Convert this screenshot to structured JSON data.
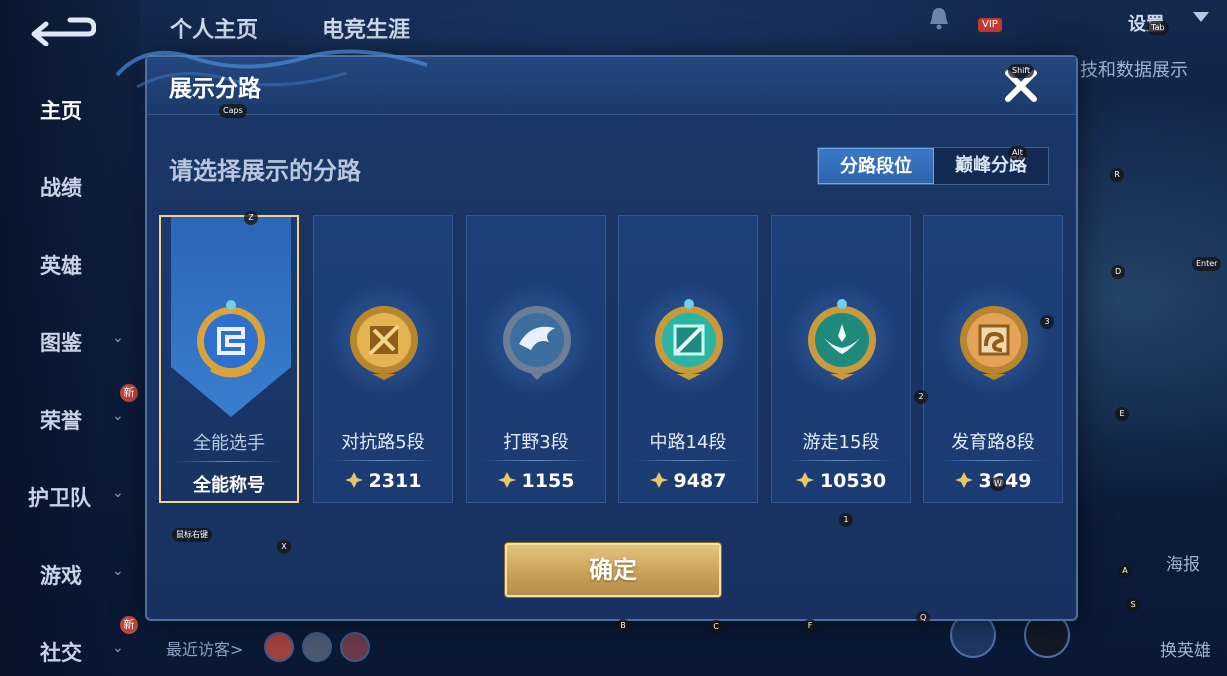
{
  "background": {
    "nav": [
      {
        "label": "主页",
        "active": true
      },
      {
        "label": "战绩"
      },
      {
        "label": "英雄"
      },
      {
        "label": "图鉴",
        "chevron": true
      },
      {
        "label": "荣誉",
        "chevron": true,
        "badge": "新"
      },
      {
        "label": "护卫队",
        "chevron": true
      },
      {
        "label": "游戏",
        "chevron": true
      },
      {
        "label": "社交",
        "chevron": true,
        "badge": "新"
      }
    ],
    "top_tabs": [
      "个人主页",
      "电竞生涯"
    ],
    "settings_label": "设置",
    "vip_label": "VIP",
    "right_partial_text": "技和数据展示",
    "recent_visitors_label": "最近访客>",
    "poster_label": "海报",
    "change_hero_label": "换英雄"
  },
  "modal": {
    "title": "展示分路",
    "subtitle": "请选择展示的分路",
    "toggle": {
      "left": "分路段位",
      "right": "巅峰分路",
      "active": "left"
    },
    "cards": [
      {
        "name": "全能选手",
        "score": "全能称号",
        "selected": true,
        "emblem": "all-round-emblem",
        "color": "#2f6fd0"
      },
      {
        "name": "对抗路5段",
        "score": "2311",
        "emblem": "clash-lane-emblem",
        "color": "#d8a33a"
      },
      {
        "name": "打野3段",
        "score": "1155",
        "emblem": "jungle-emblem",
        "color": "#8fa6bf"
      },
      {
        "name": "中路14段",
        "score": "9487",
        "emblem": "mid-lane-emblem",
        "color": "#2bb3a4"
      },
      {
        "name": "游走15段",
        "score": "10530",
        "emblem": "roam-emblem",
        "color": "#1f9a8a"
      },
      {
        "name": "发育路8段",
        "score": "3649",
        "emblem": "farm-lane-emblem",
        "color": "#d88c3a"
      }
    ],
    "confirm_label": "确定"
  },
  "key_hints": [
    "Tab",
    "Shift",
    "Caps",
    "Alt",
    "R",
    "Z",
    "D",
    "Enter",
    "3",
    "2",
    "E",
    "W",
    "1",
    "X",
    "鼠标右键",
    "A",
    "S",
    "B",
    "C",
    "F",
    "Q"
  ],
  "colors": {
    "accent_gold": "#f1d488",
    "panel_blue": "#1b3767",
    "toggle_on": "#3a79c8"
  }
}
